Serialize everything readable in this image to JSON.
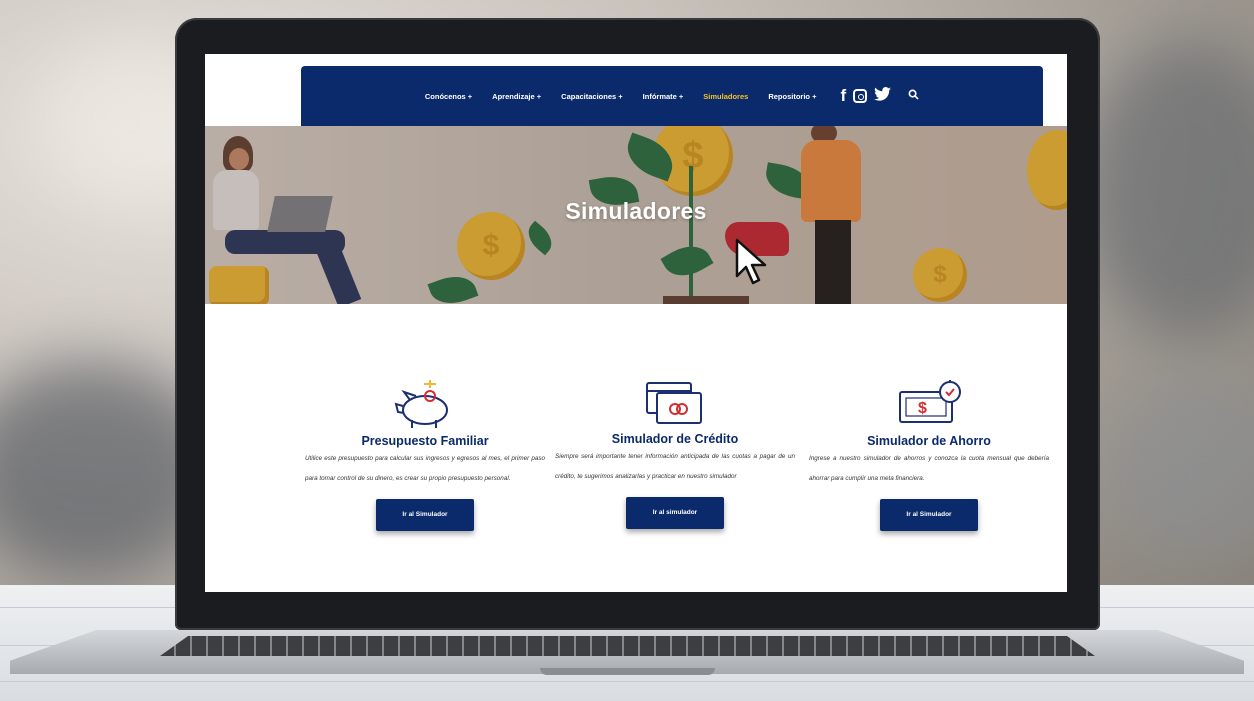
{
  "nav": {
    "items": [
      {
        "label": "Conócenos +",
        "active": false
      },
      {
        "label": "Aprendizaje +",
        "active": false
      },
      {
        "label": "Capacitaciones +",
        "active": false
      },
      {
        "label": "Infórmate +",
        "active": false
      },
      {
        "label": "Simuladores",
        "active": true
      },
      {
        "label": "Repositorio +",
        "active": false
      }
    ],
    "social": {
      "facebook": "f",
      "twitter": "🐦",
      "search": "🔍"
    },
    "icons": [
      "facebook-icon",
      "instagram-icon",
      "twitter-icon",
      "search-icon"
    ]
  },
  "hero": {
    "title": "Simuladores"
  },
  "cards": [
    {
      "title": "Presupuesto Familiar",
      "description": "Utilice este presupuesto para calcular sus ingresos y egresos al mes, el primer paso para tomar control de su dinero, es crear su propio presupuesto personal.",
      "button": "Ir al Simulador",
      "icon": "piggy-bank-icon"
    },
    {
      "title": "Simulador de Crédito",
      "description": "Siempre será importante tener información anticipada de las cuotas a pagar de un crédito, te sugerimos analizarlas y practicar en nuestro simulador",
      "button": "Ir al simulador",
      "icon": "credit-card-icon"
    },
    {
      "title": "Simulador de Ahorro",
      "description": "Ingrese a nuestro simulador de ahorros y conozca la cuota mensual que debería ahorrar para cumplir una meta financiera.",
      "button": "Ir al Simulador",
      "icon": "savings-clock-icon"
    }
  ],
  "colors": {
    "brand": "#0b2a6b",
    "active_nav": "#f4c22b",
    "coin": "#f0b82f"
  }
}
